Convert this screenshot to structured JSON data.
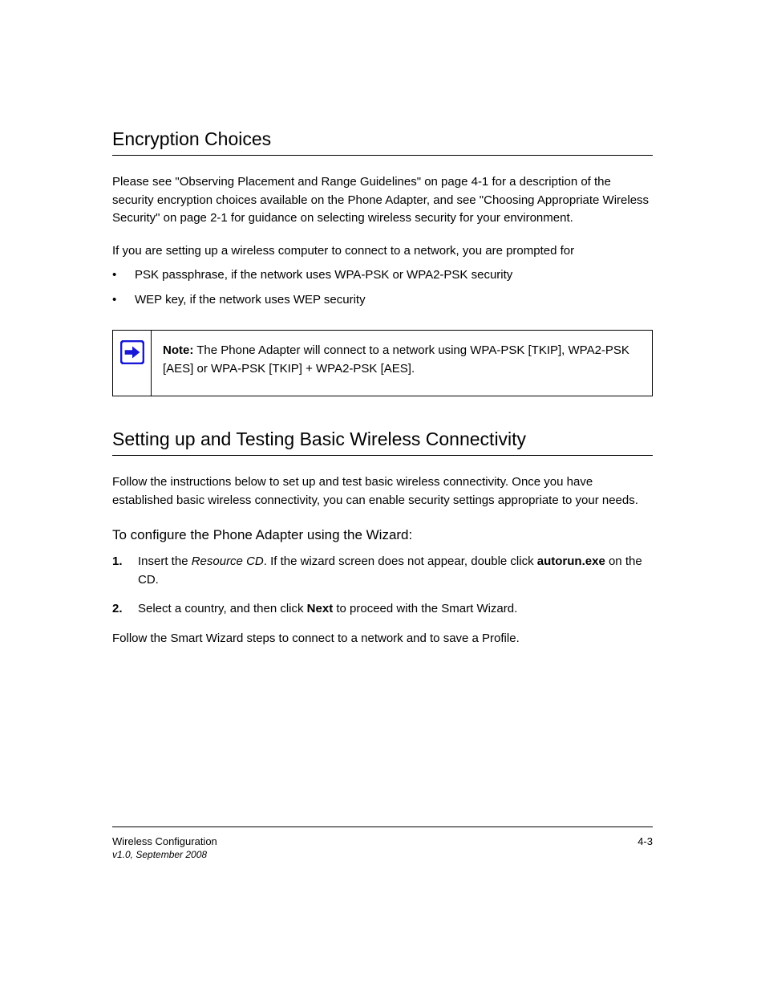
{
  "sections": {
    "s1": {
      "heading": "Encryption Choices",
      "p1": "Please see \"Observing Placement and Range Guidelines\" on page 4-1 for a description of the security encryption choices available on the Phone Adapter, and see \"Choosing Appropriate Wireless Security\" on page 2-1 for guidance on selecting wireless security for your environment.",
      "p2": "If you are setting up a wireless computer to connect to a network, you are prompted for",
      "bullets": [
        "PSK passphrase, if the network uses WPA-PSK or WPA2-PSK security",
        "WEP key, if the network uses WEP security"
      ]
    },
    "note": {
      "label": "Note:",
      "text": "The Phone Adapter will connect to a network using WPA-PSK [TKIP], WPA2-PSK [AES] or WPA-PSK [TKIP] + WPA2-PSK [AES]."
    },
    "s2": {
      "heading": "Setting up and Testing Basic Wireless Connectivity",
      "p1": "Follow the instructions below to set up and test basic wireless connectivity. Once you have established basic wireless connectivity, you can enable security settings appropriate to your needs.",
      "sub1": "To configure the Phone Adapter using the Wizard:",
      "ol1": {
        "n": "1.",
        "text_a": "Insert the ",
        "cd": "Resource CD",
        "text_b": ". If the wizard screen does not appear, double click ",
        "auto": "autorun.exe",
        "text_c": " on the CD."
      },
      "ol2": {
        "n": "2.",
        "text_a": "Select a country, and then click ",
        "btn": "Next",
        "text_b": " to proceed with the Smart Wizard."
      },
      "p2": "Follow the Smart Wizard steps to connect to a network and to save a Profile."
    },
    "footer": {
      "left": "Wireless Configuration",
      "right": "4-3",
      "ver": "v1.0, September 2008"
    }
  }
}
